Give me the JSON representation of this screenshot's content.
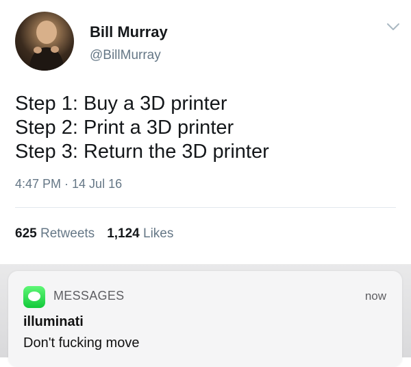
{
  "tweet": {
    "display_name": "Bill Murray",
    "handle": "@BillMurray",
    "lines": [
      "Step 1: Buy a 3D printer",
      "Step 2: Print a 3D printer",
      "Step 3: Return the 3D printer"
    ],
    "timestamp": "4:47 PM · 14 Jul 16",
    "retweets_count": "625",
    "retweets_label": "Retweets",
    "likes_count": "1,124",
    "likes_label": "Likes",
    "menu_icon": "chevron-down-icon",
    "text_color": "#14171a",
    "muted_color": "#657786"
  },
  "notification": {
    "app_name": "MESSAGES",
    "time": "now",
    "title": "illuminati",
    "body": "Don't fucking move",
    "app_icon": "messages-app-icon",
    "accent_color": "#2fd950"
  }
}
